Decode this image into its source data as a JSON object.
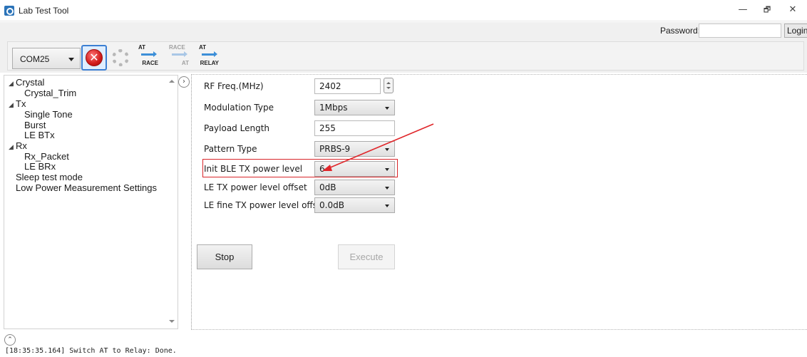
{
  "window": {
    "title": "Lab Test Tool",
    "controls": {
      "minimize": "—",
      "maximize": "🗗",
      "close": "✕"
    }
  },
  "topbar": {
    "password_label": "Password:",
    "password_value": "",
    "login_label": "Login"
  },
  "toolbar": {
    "port": "COM25",
    "disconnect_icon": "x-circle-icon",
    "settings_icon": "gear-icon",
    "at_race": {
      "top": "AT",
      "bottom": "RACE"
    },
    "race_at": {
      "top": "RACE",
      "bottom": "AT"
    },
    "at_relay": {
      "top": "AT",
      "bottom": "RELAY"
    }
  },
  "tree": {
    "items": [
      {
        "label": "Crystal",
        "expander": "◢"
      },
      {
        "label": "Crystal_Trim"
      },
      {
        "label": "Tx",
        "expander": "◢"
      },
      {
        "label": "Single Tone"
      },
      {
        "label": "Burst"
      },
      {
        "label": "LE BTx"
      },
      {
        "label": "Rx",
        "expander": "◢"
      },
      {
        "label": "Rx_Packet"
      },
      {
        "label": "LE BRx"
      },
      {
        "label": "Sleep test mode"
      },
      {
        "label": "Low Power Measurement Settings"
      }
    ]
  },
  "form": {
    "rf_freq": {
      "label": "RF Freq.(MHz)",
      "value": "2402"
    },
    "modulation": {
      "label": "Modulation Type",
      "value": "1Mbps"
    },
    "payload": {
      "label": "Payload Length",
      "value": "255"
    },
    "pattern": {
      "label": "Pattern Type",
      "value": "PRBS-9"
    },
    "init_power": {
      "label": "Init BLE TX power level",
      "value": "6"
    },
    "power_offset": {
      "label": "LE TX power level offset",
      "value": "0dB"
    },
    "fine_offset": {
      "label": "LE fine TX power level offset",
      "value": "0.0dB"
    },
    "stop_label": "Stop",
    "execute_label": "Execute"
  },
  "log": {
    "line": "[18:35:35.164] Switch AT to Relay: Done."
  },
  "colors": {
    "highlight": "#d9262a",
    "annotation_arrow": "#e0262a",
    "accent": "#3c7fd3"
  }
}
